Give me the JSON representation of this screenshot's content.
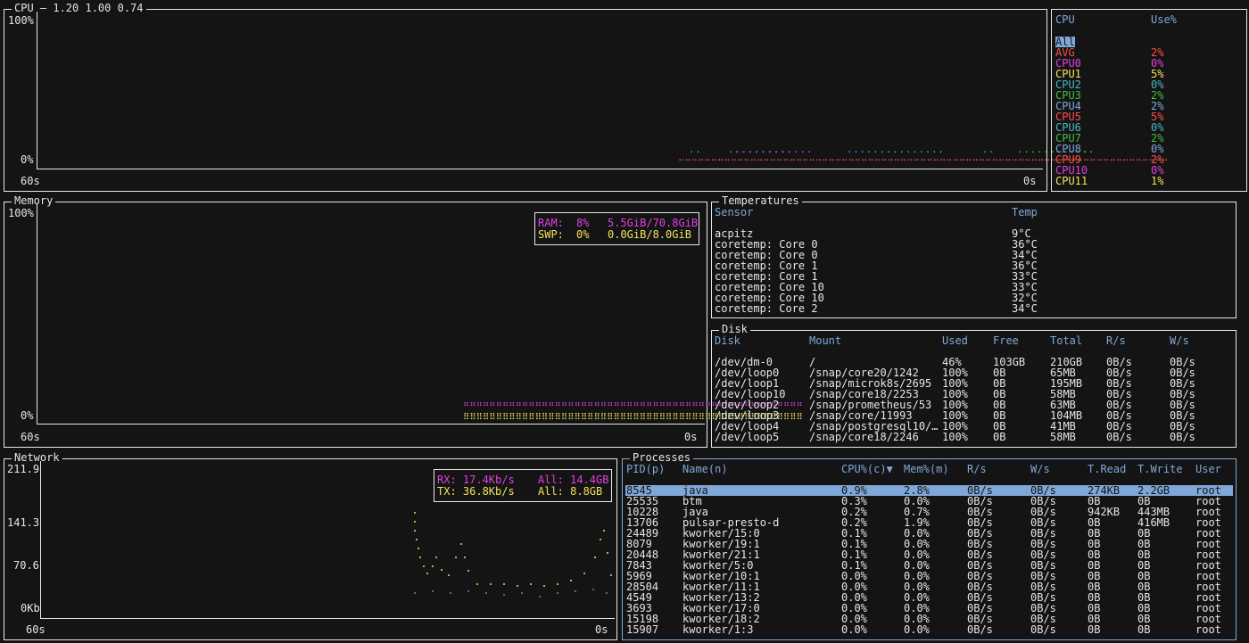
{
  "cpu_panel": {
    "title": "CPU — 1.20 1.00 0.74",
    "y_max": "100%",
    "y_min": "0%",
    "x_left": "60s",
    "x_right": "0s"
  },
  "cpu_legend": {
    "header_cpu": "CPU",
    "header_use": "Use%",
    "all_label": "All",
    "items": [
      {
        "name": "AVG",
        "value": "2%",
        "color": "#ff4d4d"
      },
      {
        "name": "CPU0",
        "value": "0%",
        "color": "#e040e0"
      },
      {
        "name": "CPU1",
        "value": "5%",
        "color": "#f2e25a"
      },
      {
        "name": "CPU2",
        "value": "0%",
        "color": "#45b8c8"
      },
      {
        "name": "CPU3",
        "value": "2%",
        "color": "#3fbf3f"
      },
      {
        "name": "CPU4",
        "value": "2%",
        "color": "#7fa8d8"
      },
      {
        "name": "CPU5",
        "value": "5%",
        "color": "#ff4d4d"
      },
      {
        "name": "CPU6",
        "value": "0%",
        "color": "#45b8c8"
      },
      {
        "name": "CPU7",
        "value": "2%",
        "color": "#3fbf3f"
      },
      {
        "name": "CPU8",
        "value": "0%",
        "color": "#7fa8d8"
      },
      {
        "name": "CPU9",
        "value": "2%",
        "color": "#ff4d4d"
      },
      {
        "name": "CPU10",
        "value": "0%",
        "color": "#e040e0"
      },
      {
        "name": "CPU11",
        "value": "1%",
        "color": "#f2e25a"
      }
    ]
  },
  "memory_panel": {
    "title": "Memory",
    "y_max": "100%",
    "y_min": "0%",
    "x_left": "60s",
    "x_right": "0s",
    "ram_label": "RAM:",
    "ram_pct": "8%",
    "ram_usage": "5.5GiB/70.8GiB",
    "swp_label": "SWP:",
    "swp_pct": "0%",
    "swp_usage": "0.0GiB/8.0GiB",
    "ram_color": "#e040e0",
    "swp_color": "#f2e25a"
  },
  "temps_panel": {
    "title": "Temperatures",
    "col_sensor": "Sensor",
    "col_temp": "Temp",
    "rows": [
      {
        "sensor": "acpitz",
        "temp": "9°C"
      },
      {
        "sensor": "coretemp: Core 0",
        "temp": "36°C"
      },
      {
        "sensor": "coretemp: Core 0",
        "temp": "34°C"
      },
      {
        "sensor": "coretemp: Core 1",
        "temp": "36°C"
      },
      {
        "sensor": "coretemp: Core 1",
        "temp": "33°C"
      },
      {
        "sensor": "coretemp: Core 10",
        "temp": "33°C"
      },
      {
        "sensor": "coretemp: Core 10",
        "temp": "32°C"
      },
      {
        "sensor": "coretemp: Core 2",
        "temp": "34°C"
      }
    ]
  },
  "disk_panel": {
    "title": "Disk",
    "headers": [
      "Disk",
      "Mount",
      "Used",
      "Free",
      "Total",
      "R/s",
      "W/s"
    ],
    "rows": [
      [
        "/dev/dm-0",
        "/",
        "46%",
        "103GB",
        "210GB",
        "0B/s",
        "0B/s"
      ],
      [
        "/dev/loop0",
        "/snap/core20/1242",
        "100%",
        "0B",
        "65MB",
        "0B/s",
        "0B/s"
      ],
      [
        "/dev/loop1",
        "/snap/microk8s/2695",
        "100%",
        "0B",
        "195MB",
        "0B/s",
        "0B/s"
      ],
      [
        "/dev/loop10",
        "/snap/core18/2253",
        "100%",
        "0B",
        "58MB",
        "0B/s",
        "0B/s"
      ],
      [
        "/dev/loop2",
        "/snap/prometheus/53",
        "100%",
        "0B",
        "63MB",
        "0B/s",
        "0B/s"
      ],
      [
        "/dev/loop3",
        "/snap/core/11993",
        "100%",
        "0B",
        "104MB",
        "0B/s",
        "0B/s"
      ],
      [
        "/dev/loop4",
        "/snap/postgresql10/…",
        "100%",
        "0B",
        "41MB",
        "0B/s",
        "0B/s"
      ],
      [
        "/dev/loop5",
        "/snap/core18/2246",
        "100%",
        "0B",
        "58MB",
        "0B/s",
        "0B/s"
      ]
    ]
  },
  "network_panel": {
    "title": "Network",
    "y_ticks": [
      "211.9",
      "141.3",
      "70.6",
      "0Kb"
    ],
    "x_left": "60s",
    "x_right": "0s",
    "rx_label": "RX: 17.4Kb/s",
    "rx_all": "All: 14.4GB",
    "tx_label": "TX: 36.8Kb/s",
    "tx_all": "All: 8.8GB",
    "rx_color": "#e040e0",
    "tx_color": "#f2e25a"
  },
  "process_panel": {
    "title": "Processes",
    "headers": [
      "PID(p)",
      "Name(n)",
      "CPU%(c)▼",
      "Mem%(m)",
      "R/s",
      "W/s",
      "T.Read",
      "T.Write",
      "User"
    ],
    "rows": [
      [
        "8545",
        "java",
        "0.9%",
        "2.8%",
        "0B/s",
        "0B/s",
        "274KB",
        "2.2GB",
        "root"
      ],
      [
        "25535",
        "btm",
        "0.3%",
        "0.0%",
        "0B/s",
        "0B/s",
        "0B",
        "0B",
        "root"
      ],
      [
        "10228",
        "java",
        "0.2%",
        "0.7%",
        "0B/s",
        "0B/s",
        "942KB",
        "443MB",
        "root"
      ],
      [
        "13706",
        "pulsar-presto-d",
        "0.2%",
        "1.9%",
        "0B/s",
        "0B/s",
        "0B",
        "416MB",
        "root"
      ],
      [
        "24489",
        "kworker/15:0",
        "0.1%",
        "0.0%",
        "0B/s",
        "0B/s",
        "0B",
        "0B",
        "root"
      ],
      [
        "8079",
        "kworker/19:1",
        "0.1%",
        "0.0%",
        "0B/s",
        "0B/s",
        "0B",
        "0B",
        "root"
      ],
      [
        "20448",
        "kworker/21:1",
        "0.1%",
        "0.0%",
        "0B/s",
        "0B/s",
        "0B",
        "0B",
        "root"
      ],
      [
        "7843",
        "kworker/5:0",
        "0.1%",
        "0.0%",
        "0B/s",
        "0B/s",
        "0B",
        "0B",
        "root"
      ],
      [
        "5969",
        "kworker/10:1",
        "0.0%",
        "0.0%",
        "0B/s",
        "0B/s",
        "0B",
        "0B",
        "root"
      ],
      [
        "28504",
        "kworker/11:1",
        "0.0%",
        "0.0%",
        "0B/s",
        "0B/s",
        "0B",
        "0B",
        "root"
      ],
      [
        "4549",
        "kworker/13:2",
        "0.0%",
        "0.0%",
        "0B/s",
        "0B/s",
        "0B",
        "0B",
        "root"
      ],
      [
        "3693",
        "kworker/17:0",
        "0.0%",
        "0.0%",
        "0B/s",
        "0B/s",
        "0B",
        "0B",
        "root"
      ],
      [
        "15198",
        "kworker/18:2",
        "0.0%",
        "0.0%",
        "0B/s",
        "0B/s",
        "0B",
        "0B",
        "root"
      ],
      [
        "15907",
        "kworker/1:3",
        "0.0%",
        "0.0%",
        "0B/s",
        "0B/s",
        "0B",
        "0B",
        "root"
      ]
    ]
  },
  "colors": {
    "header_blue": "#7fa8d8",
    "selected_row_bg": "#7fa8d8",
    "border": "#e8e8e8"
  }
}
